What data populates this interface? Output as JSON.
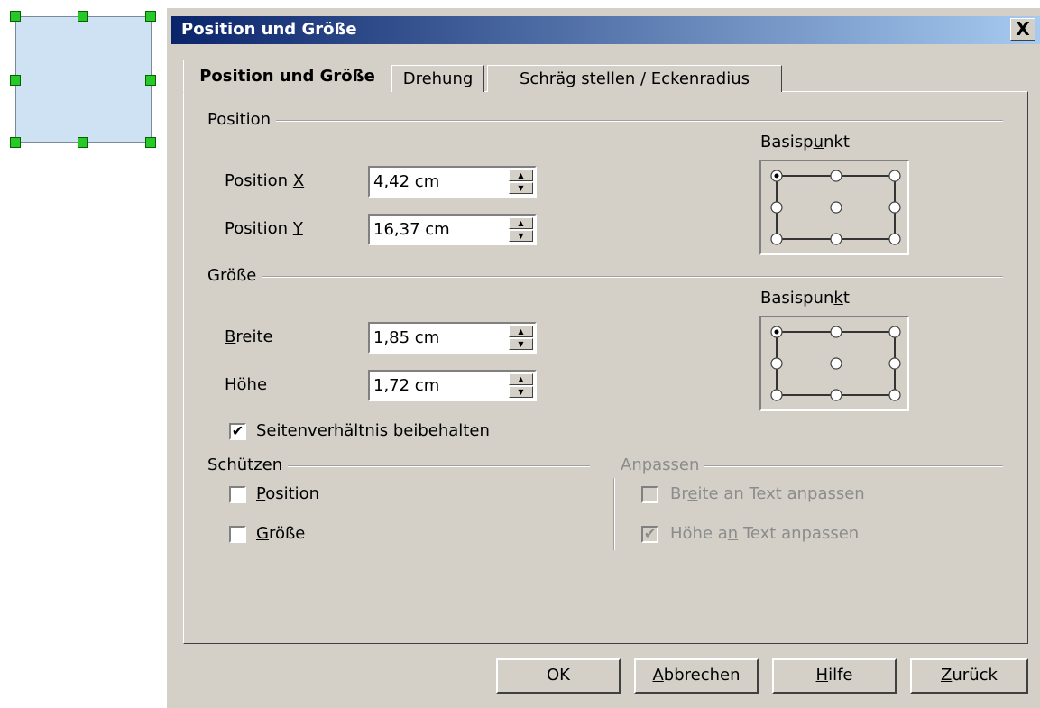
{
  "dialog": {
    "title": "Position und Größe",
    "close_glyph": "X"
  },
  "tabs": [
    {
      "label": "Position und Größe"
    },
    {
      "label": "Drehung"
    },
    {
      "label": "Schräg stellen / Eckenradius"
    }
  ],
  "position_group": {
    "label": "Position",
    "basepoint_label_pre": "Basisp",
    "basepoint_label_u": "u",
    "basepoint_label_post": "nkt",
    "x": {
      "label_pre": "Position ",
      "label_u": "X",
      "value": "4,42 cm"
    },
    "y": {
      "label_pre": "Position ",
      "label_u": "Y",
      "value": "16,37 cm"
    }
  },
  "size_group": {
    "label": "Größe",
    "basepoint_label_pre": "Basispun",
    "basepoint_label_u": "k",
    "basepoint_label_post": "t",
    "width": {
      "label_u": "B",
      "label_post": "reite",
      "value": "1,85 cm"
    },
    "height": {
      "label_u": "H",
      "label_post": "öhe",
      "value": "1,72 cm"
    },
    "keep_ratio": {
      "label_pre": "Seitenverhältnis ",
      "label_u": "b",
      "label_post": "eibehalten",
      "checked": true
    }
  },
  "protect_group": {
    "label": "Schützen",
    "position": {
      "label_u": "P",
      "label_post": "osition",
      "checked": false
    },
    "size": {
      "label_u": "G",
      "label_post": "röße",
      "checked": false
    }
  },
  "fit_group": {
    "label": "Anpassen",
    "width_to_text": {
      "label_pre": "Br",
      "label_u": "e",
      "label_post": "ite an Text anpassen",
      "checked": false
    },
    "height_to_text": {
      "label_pre": "Höhe a",
      "label_u": "n",
      "label_post": " Text anpassen",
      "checked": true
    }
  },
  "buttons": {
    "ok": "OK",
    "cancel_u": "A",
    "cancel_post": "bbrechen",
    "help_u": "H",
    "help_post": "ilfe",
    "back_u": "Z",
    "back_post": "urück"
  },
  "icons": {
    "checkmark": "✔",
    "spin_up": "▲",
    "spin_down": "▼"
  },
  "colors": {
    "title_gradient_start": "#0a246a",
    "title_gradient_end": "#a6caf0",
    "handle": "#28c828",
    "shape_fill": "#cfe2f3",
    "dialog_bg": "#d4d0c8"
  }
}
